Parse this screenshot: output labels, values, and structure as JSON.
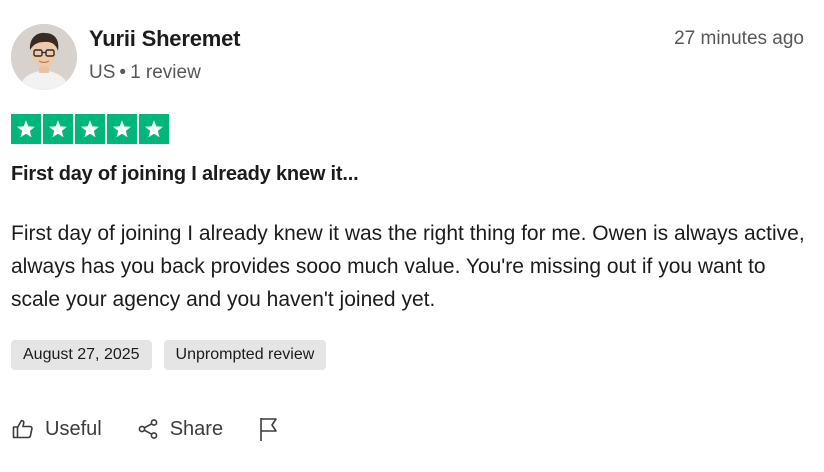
{
  "reviewer": {
    "name": "Yurii Sheremet",
    "country": "US",
    "separator": "•",
    "review_count": "1 review"
  },
  "timestamp": "27 minutes ago",
  "rating": {
    "stars": 5,
    "max": 5,
    "color": "#219653",
    "star_box_color": "#00b67a"
  },
  "review": {
    "title": "First day of joining I already knew it...",
    "body": "First day of joining I already knew it was the right thing for me. Owen is always active, always has you back provides sooo much value. You're missing out if you want to scale your agency and you haven't joined yet."
  },
  "tags": {
    "date": "August 27, 2025",
    "type": "Unprompted review"
  },
  "actions": {
    "useful": "Useful",
    "share": "Share",
    "report_icon": "flag-icon"
  }
}
